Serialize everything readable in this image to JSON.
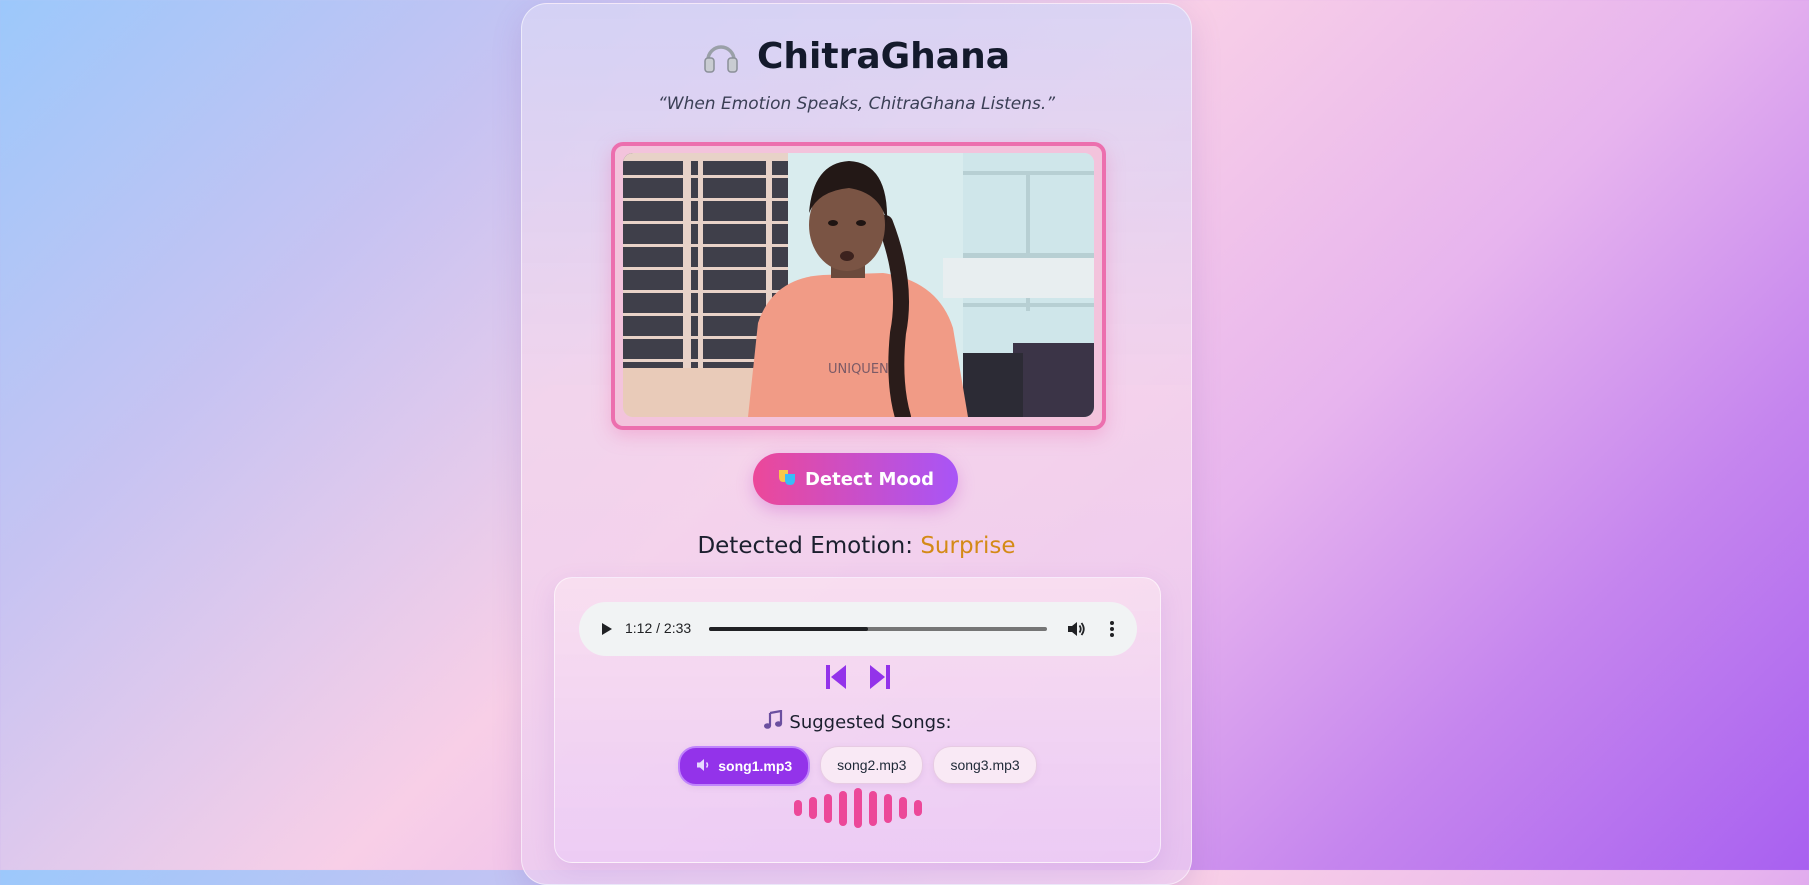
{
  "app": {
    "title": "ChitraGhana",
    "tagline": "“When Emotion Speaks, ChitraGhana Listens.”"
  },
  "video": {
    "shirt_text": "UNIQUENE"
  },
  "actions": {
    "detect_label": "Detect Mood"
  },
  "emotion": {
    "label": "Detected Emotion:",
    "value": "Surprise"
  },
  "player": {
    "time": "1:12 / 2:33",
    "progress_fraction": 0.47
  },
  "suggestions": {
    "heading": "Suggested Songs:",
    "songs": [
      "song1.mp3",
      "song2.mp3",
      "song3.mp3"
    ],
    "active_index": 0
  },
  "wave": {
    "levels": [
      0.25,
      0.45,
      0.65,
      0.85,
      1.0,
      0.85,
      0.65,
      0.45,
      0.25
    ]
  },
  "colors": {
    "accent_pink": "#ec4899",
    "accent_purple": "#a855f7",
    "emotion_value": "#d48a16",
    "active_song": "#9333ea"
  },
  "icons": {
    "title": "headphones-icon",
    "detect": "masks-icon",
    "suggestions": "music-note-icon",
    "prev": "skip-previous-icon",
    "next": "skip-next-icon",
    "active_song": "speaker-icon"
  }
}
